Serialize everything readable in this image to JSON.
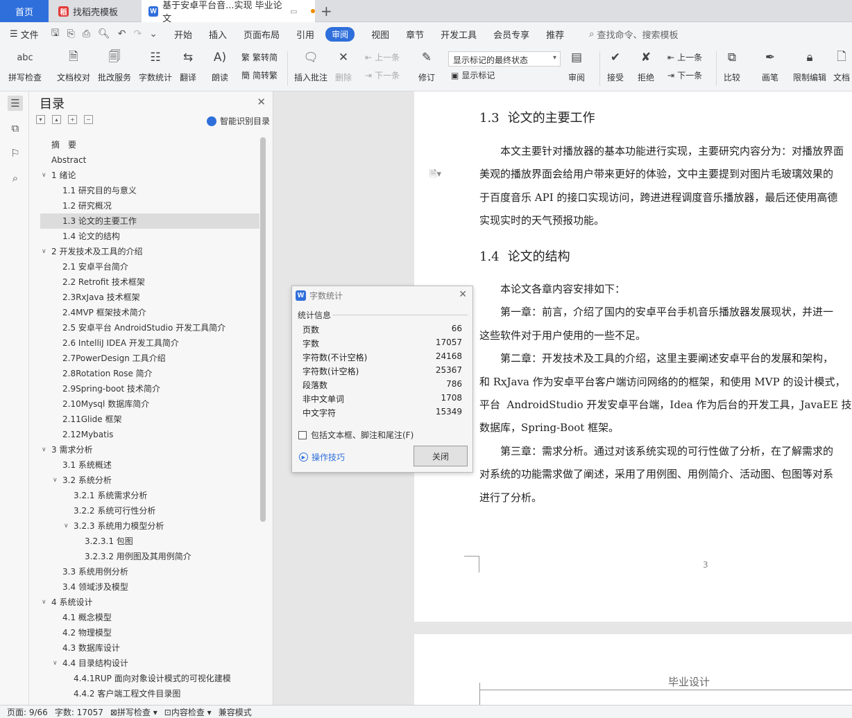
{
  "tabs": {
    "home": "首页",
    "template": "找稻壳模板",
    "doc": "基于安卓平台音...实现 毕业论文"
  },
  "menu": {
    "file": "文件",
    "items": [
      "开始",
      "插入",
      "页面布局",
      "引用"
    ],
    "active": "审阅",
    "items2": [
      "视图",
      "章节",
      "开发工具",
      "会员专享",
      "推荐"
    ],
    "search": "查找命令、搜索模板"
  },
  "ribbon": {
    "spell": "拼写检查",
    "proof": "文档校对",
    "batch": "批改服务",
    "wordcount": "字数统计",
    "translate": "翻译",
    "read": "朗读",
    "trad": "繁转简",
    "simp": "简转繁",
    "comment": "插入批注",
    "delete": "删除",
    "prev": "上一条",
    "next": "下一条",
    "track": "修订",
    "markup_state": "显示标记的最终状态",
    "show_markup": "显示标记",
    "review": "审阅",
    "accept": "接受",
    "reject": "拒绝",
    "prev2": "上一条",
    "next2": "下一条",
    "compare": "比较",
    "pen": "画笔",
    "restrict": "限制编辑",
    "doc": "文档"
  },
  "toc": {
    "title": "目录",
    "smart": "智能识别目录",
    "items": [
      {
        "t": "摘　要",
        "lv": 0,
        "c": ""
      },
      {
        "t": "Abstract",
        "lv": 0,
        "c": ""
      },
      {
        "t": "1 绪论",
        "lv": 0,
        "c": "v"
      },
      {
        "t": "1.1 研究目的与意义",
        "lv": 1,
        "c": ""
      },
      {
        "t": "1.2 研究概况",
        "lv": 1,
        "c": ""
      },
      {
        "t": "1.3  论文的主要工作",
        "lv": 1,
        "c": "",
        "hl": true
      },
      {
        "t": "1.4  论文的结构",
        "lv": 1,
        "c": ""
      },
      {
        "t": "2 开发技术及工具的介绍",
        "lv": 0,
        "c": "v"
      },
      {
        "t": "2.1  安卓平台简介",
        "lv": 1,
        "c": ""
      },
      {
        "t": "2.2 Retrofit 技术框架",
        "lv": 1,
        "c": ""
      },
      {
        "t": "2.3RxJava 技术框架",
        "lv": 1,
        "c": ""
      },
      {
        "t": "2.4MVP 框架技术简介",
        "lv": 1,
        "c": ""
      },
      {
        "t": "2.5 安卓平台  AndroidStudio 开发工具简介",
        "lv": 1,
        "c": ""
      },
      {
        "t": "2.6 IntelliJ  IDEA 开发工具简介",
        "lv": 1,
        "c": ""
      },
      {
        "t": "2.7PowerDesign 工具介绍",
        "lv": 1,
        "c": ""
      },
      {
        "t": "2.8Rotation Rose 简介",
        "lv": 1,
        "c": ""
      },
      {
        "t": "2.9Spring-boot 技术简介",
        "lv": 1,
        "c": ""
      },
      {
        "t": "2.10Mysql 数据库简介",
        "lv": 1,
        "c": ""
      },
      {
        "t": "2.11Glide 框架",
        "lv": 1,
        "c": ""
      },
      {
        "t": "2.12Mybatis",
        "lv": 1,
        "c": ""
      },
      {
        "t": "3 需求分析",
        "lv": 0,
        "c": "v"
      },
      {
        "t": "3.1 系统概述",
        "lv": 1,
        "c": ""
      },
      {
        "t": "3.2 系统分析",
        "lv": 1,
        "c": "v"
      },
      {
        "t": "3.2.1 系统需求分析",
        "lv": 2,
        "c": ""
      },
      {
        "t": "3.2.2 系统可行性分析",
        "lv": 2,
        "c": ""
      },
      {
        "t": "3.2.3 系统用力模型分析",
        "lv": 2,
        "c": "v"
      },
      {
        "t": "3.2.3.1 包图",
        "lv": 3,
        "c": ""
      },
      {
        "t": "3.2.3.2 用例图及其用例简介",
        "lv": 3,
        "c": ""
      },
      {
        "t": "3.3 系统用例分析",
        "lv": 1,
        "c": ""
      },
      {
        "t": "3.4 领域涉及模型",
        "lv": 1,
        "c": ""
      },
      {
        "t": "4 系统设计",
        "lv": 0,
        "c": "v"
      },
      {
        "t": "4.1 概念模型",
        "lv": 1,
        "c": ""
      },
      {
        "t": "4.2 物理模型",
        "lv": 1,
        "c": ""
      },
      {
        "t": "4.3  数据库设计",
        "lv": 1,
        "c": ""
      },
      {
        "t": "4.4  目录结构设计",
        "lv": 1,
        "c": "v"
      },
      {
        "t": "4.4.1RUP 面向对象设计模式的可视化建模",
        "lv": 2,
        "c": ""
      },
      {
        "t": "4.4.2 客户端工程文件目录图",
        "lv": 2,
        "c": ""
      }
    ]
  },
  "doc": {
    "h13": {
      "num": "1.3",
      "text": "论文的主要工作"
    },
    "p13": "　　本文主要针对播放器的基本功能进行实现，主要研究内容分为：对播放界面\n美观的播放界面会给用户带来更好的体验，文中主要提到对图片毛玻璃效果的\n于百度音乐 API 的接口实现访问，跨进进程调度音乐播放器，最后还使用高德\n实现实时的天气预报功能。",
    "h14": {
      "num": "1.4",
      "text": "论文的结构"
    },
    "p14": "　　本论文各章内容安排如下：\n　　第一章：前言，介绍了国内的安卓平台手机音乐播放器发展现状，并进一\n这些软件对于用户使用的一些不足。\n　　第二章：开发技术及工具的介绍，这里主要阐述安卓平台的发展和架构，\n和 RxJava 作为安卓平台客户端访问网络的的框架，和使用 MVP 的设计模式，\n平台  AndroidStudio 开发安卓平台端，Idea 作为后台的开发工具，JavaEE 技术\n数据库，Spring-Boot 框架。\n　　第三章：需求分析。通过对该系统实现的可行性做了分析，在了解需求的\n对系统的功能需求做了阐述，采用了用例图、用例简介、活动图、包图等对系\n进行了分析。",
    "page_number": "3",
    "page2_header": "毕业设计"
  },
  "wordcount": {
    "title": "字数统计",
    "section": "统计信息",
    "rows": [
      {
        "k": "页数",
        "v": "66"
      },
      {
        "k": "字数",
        "v": "17057"
      },
      {
        "k": "字符数(不计空格)",
        "v": "24168"
      },
      {
        "k": "字符数(计空格)",
        "v": "25367"
      },
      {
        "k": "段落数",
        "v": "786"
      },
      {
        "k": "非中文单词",
        "v": "1708"
      },
      {
        "k": "中文字符",
        "v": "15349"
      }
    ],
    "checkbox": "包括文本框、脚注和尾注(F)",
    "tips": "操作技巧",
    "close": "关闭"
  },
  "status": {
    "page": "页面: 9/66",
    "words": "字数: 17057",
    "spell": "拼写检查",
    "content": "内容检查",
    "compat": "兼容模式"
  }
}
